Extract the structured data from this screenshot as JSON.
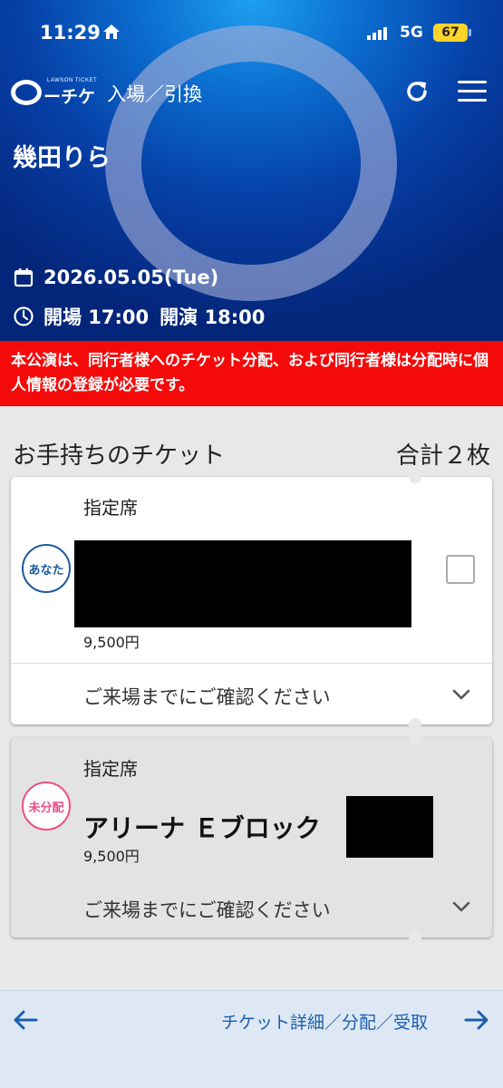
{
  "status_bar": {
    "time": "11:29",
    "network": "5G",
    "battery": "67"
  },
  "header": {
    "logo_small": "LAWSON TICKET",
    "logo_text": "ーチケ",
    "title": "入場／引換"
  },
  "event": {
    "artist": "幾田りら",
    "date": "2026.05.05(Tue)",
    "open_time": "開場 17:00",
    "start_time": "開演 18:00"
  },
  "notice": "本公演は、同行者様へのチケット分配、および同行者様は分配時に個人情報の登録が必要です。",
  "tickets_section": {
    "heading": "お手持ちのチケット",
    "total": "合計２枚"
  },
  "tickets": [
    {
      "seat_type": "指定席",
      "owner": "あなた",
      "price": "9,500円",
      "confirm": "ご来場までにご確認ください"
    },
    {
      "seat_type": "指定席",
      "owner": "未分配",
      "seat_block": "アリーナ Ｅブロック",
      "price": "9,500円",
      "confirm": "ご来場までにご確認ください"
    }
  ],
  "bottom_bar": {
    "label": "チケット詳細／分配／受取"
  },
  "colors": {
    "notice_bg": "#f50a0a",
    "owner_you": "#1b5aa0",
    "owner_unassigned": "#ec4f88",
    "link": "#1c5fae",
    "battery": "#ffd42a"
  },
  "icons": [
    "home-icon",
    "signal-icon",
    "refresh-icon",
    "menu-icon",
    "calendar-icon",
    "clock-icon",
    "chevron-down-icon",
    "back-arrow-icon",
    "forward-arrow-icon"
  ]
}
